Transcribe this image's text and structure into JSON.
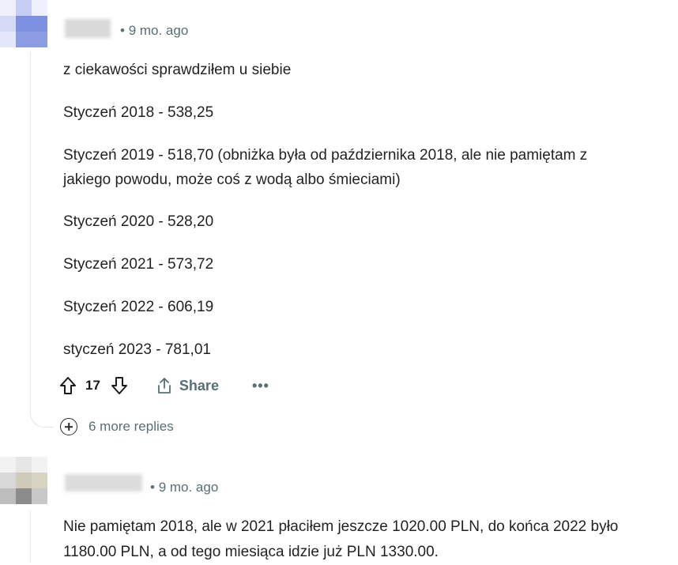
{
  "comment1": {
    "time": "9 mo. ago",
    "intro": "z ciekawości sprawdziłem u siebie",
    "lines": [
      "Styczeń 2018 - 538,25",
      "Styczeń 2019 - 518,70   (obniżka była od października 2018, ale nie pamiętam z",
      "jakiego powodu, może coś z wodą albo śmieciami)",
      "Styczeń 2020 - 528,20",
      "Styczeń 2021 - 573,72",
      "Styczeń 2022 - 606,19",
      "styczeń 2023 - 781,01"
    ],
    "votes": "17",
    "share_label": "Share",
    "more_label": "•••",
    "more_replies": "6 more replies",
    "icons": {
      "upvote": "upvote-arrow-icon",
      "downvote": "downvote-arrow-icon",
      "share": "share-icon",
      "expand": "plus-circle-icon"
    }
  },
  "comment2": {
    "time": "9 mo. ago",
    "text": "Nie pamiętam 2018, ale w 2021 płaciłem jeszcze 1020.00 PLN, do końca 2022 było 1180.00 PLN, a od tego miesiąca idzie już PLN 1330.00."
  },
  "colors": {
    "meta": "#576f76",
    "text": "#1f2123",
    "thread": "#e4e6e8"
  }
}
